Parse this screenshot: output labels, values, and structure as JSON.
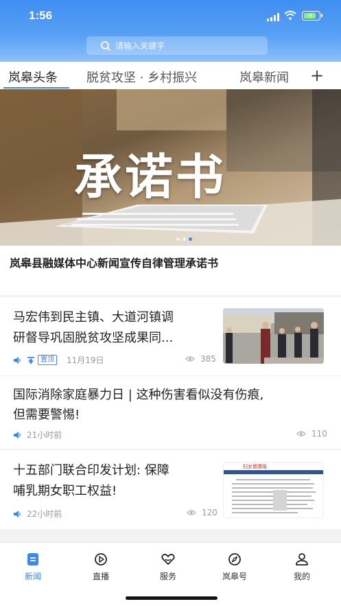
{
  "status_bar": {
    "time": "1:56",
    "battery_level": 0.85
  },
  "search": {
    "placeholder": "请输入关键字"
  },
  "tabs": [
    {
      "label": "岚皋头条",
      "active": true
    },
    {
      "label": "脱贫攻坚 · 乡村振兴",
      "active": false
    },
    {
      "label": "岚皋新闻",
      "active": false
    }
  ],
  "add_channel_label": "+",
  "banner": {
    "image_text": "承诺书",
    "title": "岚皋县融媒体中心新闻宣传自律管理承诺书",
    "slide_count": 3,
    "active_slide": 2
  },
  "news": [
    {
      "title_line1": "马宏伟到民主镇、大道河镇调",
      "title_line2": "研督导巩固脱贫攻坚成果同...",
      "pinned_label": "置顶",
      "date": "11月19日",
      "views": "385"
    },
    {
      "title_line1": "国际消除家庭暴力日 | 这种伤害看似没有伤痕,",
      "title_line2": "但需要警惕!",
      "date": "21小时前",
      "views": "110"
    },
    {
      "title_line1": "十五部门联合印发计划: 保障",
      "title_line2": "哺乳期女职工权益!",
      "thumb_heading": "妇女健康报",
      "date": "22小时前",
      "views": "120"
    }
  ],
  "tabbar": [
    {
      "label": "新闻",
      "icon": "news-icon",
      "active": true
    },
    {
      "label": "直播",
      "icon": "live-icon",
      "active": false
    },
    {
      "label": "服务",
      "icon": "service-icon",
      "active": false
    },
    {
      "label": "岚皋号",
      "icon": "compass-icon",
      "active": false
    },
    {
      "label": "我的",
      "icon": "profile-icon",
      "active": false
    }
  ],
  "colors": {
    "accent": "#3a88f0",
    "header_top": "#3f8df1"
  }
}
